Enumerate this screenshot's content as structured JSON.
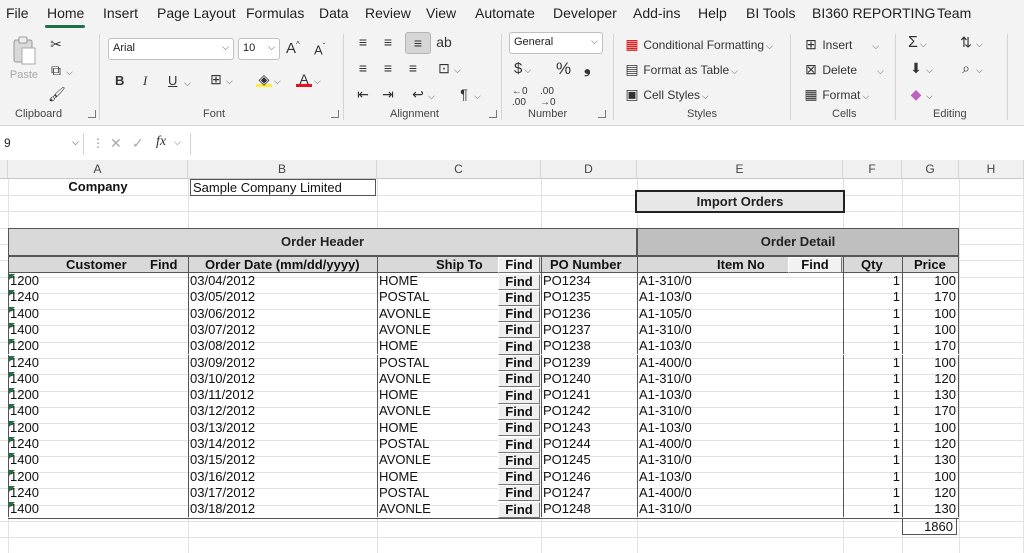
{
  "ribbon_tabs": [
    "File",
    "Home",
    "Insert",
    "Page Layout",
    "Formulas",
    "Data",
    "Review",
    "View",
    "Automate",
    "Developer",
    "Add-ins",
    "Help",
    "BI Tools",
    "BI360 REPORTING",
    "Team"
  ],
  "active_tab": "Home",
  "groups": {
    "clipboard": "Clipboard",
    "font": "Font",
    "alignment": "Alignment",
    "number": "Number",
    "styles": "Styles",
    "cells": "Cells",
    "editing": "Editing"
  },
  "clipboard": {
    "paste_label": "Paste"
  },
  "font": {
    "name": "Arial",
    "size": "10",
    "bold": "B",
    "italic": "I",
    "underline": "U"
  },
  "number": {
    "format": "General",
    "currency": "$",
    "percent": "%",
    "comma": "❟"
  },
  "styles": {
    "conditional": "Conditional Formatting",
    "format_table": "Format as Table",
    "cell_styles": "Cell Styles"
  },
  "cells": {
    "insert": "Insert",
    "delete": "Delete",
    "format": "Format"
  },
  "formula_bar": {
    "namebox": "9",
    "fx": "fx",
    "value": ""
  },
  "columns": [
    "A",
    "B",
    "C",
    "D",
    "E",
    "F",
    "G",
    "H"
  ],
  "sheet": {
    "company_label": "Company",
    "company_value": "Sample Company Limited",
    "import_button": "Import Orders",
    "order_header": "Order Header",
    "order_detail": "Order Detail",
    "headers": {
      "customer": "Customer",
      "order_date": "Order Date (mm/dd/yyyy)",
      "ship_to": "Ship To",
      "po_number": "PO Number",
      "item_no": "Item No",
      "qty": "Qty",
      "price": "Price"
    },
    "find_label": "Find",
    "rows": [
      [
        "1200",
        "03/04/2012",
        "HOME",
        "PO1234",
        "A1-310/0",
        "1",
        "100"
      ],
      [
        "1240",
        "03/05/2012",
        "POSTAL",
        "PO1235",
        "A1-103/0",
        "1",
        "170"
      ],
      [
        "1400",
        "03/06/2012",
        "AVONLE",
        "PO1236",
        "A1-105/0",
        "1",
        "100"
      ],
      [
        "1400",
        "03/07/2012",
        "AVONLE",
        "PO1237",
        "A1-310/0",
        "1",
        "100"
      ],
      [
        "1200",
        "03/08/2012",
        "HOME",
        "PO1238",
        "A1-103/0",
        "1",
        "170"
      ],
      [
        "1240",
        "03/09/2012",
        "POSTAL",
        "PO1239",
        "A1-400/0",
        "1",
        "100"
      ],
      [
        "1400",
        "03/10/2012",
        "AVONLE",
        "PO1240",
        "A1-310/0",
        "1",
        "120"
      ],
      [
        "1200",
        "03/11/2012",
        "HOME",
        "PO1241",
        "A1-103/0",
        "1",
        "130"
      ],
      [
        "1400",
        "03/12/2012",
        "AVONLE",
        "PO1242",
        "A1-310/0",
        "1",
        "170"
      ],
      [
        "1200",
        "03/13/2012",
        "HOME",
        "PO1243",
        "A1-103/0",
        "1",
        "100"
      ],
      [
        "1240",
        "03/14/2012",
        "POSTAL",
        "PO1244",
        "A1-400/0",
        "1",
        "120"
      ],
      [
        "1400",
        "03/15/2012",
        "AVONLE",
        "PO1245",
        "A1-310/0",
        "1",
        "130"
      ],
      [
        "1200",
        "03/16/2012",
        "HOME",
        "PO1246",
        "A1-103/0",
        "1",
        "100"
      ],
      [
        "1240",
        "03/17/2012",
        "POSTAL",
        "PO1247",
        "A1-400/0",
        "1",
        "120"
      ],
      [
        "1400",
        "03/18/2012",
        "AVONLE",
        "PO1248",
        "A1-310/0",
        "1",
        "130"
      ]
    ],
    "total": "1860"
  },
  "colors": {
    "accent": "#1e7145",
    "band": "#d9d9d9",
    "detail_band": "#bfbfbf"
  }
}
